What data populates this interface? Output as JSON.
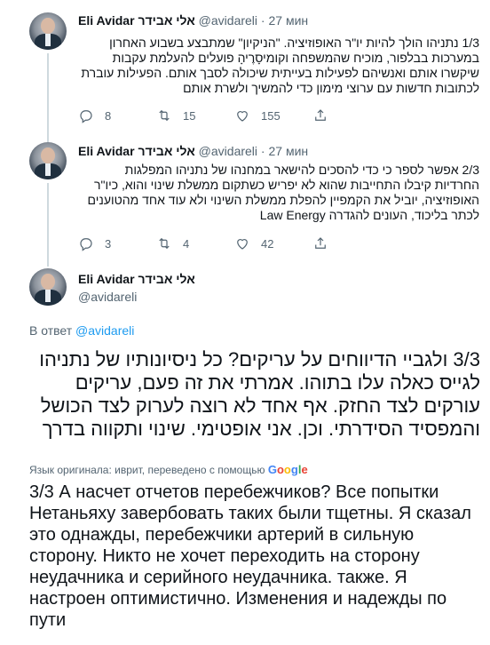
{
  "tweets": [
    {
      "name": "Eli Avidar אלי אבידר",
      "handle": "@avidareli",
      "separator": "·",
      "time": "27 мин",
      "text": "1/3 נתניהו הולך להיות יו\"ר האופוזיציה. \"הניקיון\" שמתבצע בשבוע האחרון במערכות בבלפור, מוכיח שהמשפחה וקומיסָרֶיהָ פועלים להעלמת עקבות שיקשרו אותם ואנשיהם לפעילות בעייתית שיכולה לסבך אותם. הפעילות עוברת לכתובות חדשות עם ערוצי מימון כדי להמשיך ולשרת אותם",
      "replies": "8",
      "retweets": "15",
      "likes": "155"
    },
    {
      "name": "Eli Avidar אלי אבידר",
      "handle": "@avidareli",
      "separator": "·",
      "time": "27 мин",
      "text": "2/3 אפשר לספר כי כדי להסכים להישאר במחנהו של נתניהו המפלגות החרדיות קיבלו התחייבות שהוא לא יפריש כשתקום ממשלת שינוי והוא, כיו\"ר האופוזיציה, יוביל את הקמפיין להפלת ממשלת השינוי ולא עוד אחד מהטוענים לכתר בליכוד, העונים להגדרה Law Energy",
      "replies": "3",
      "retweets": "4",
      "likes": "42"
    }
  ],
  "main_tweet": {
    "name": "Eli Avidar אלי אבידר",
    "handle": "@avidareli",
    "reply_prefix": "В ответ",
    "reply_handle": "@avidareli",
    "hebrew_text": "3/3 ולגביי הדיווחים על עריקים? כל ניסיונותיו של נתניהו לגייס כאלה עלו בתוהו. אמרתי את זה פעם, עריקים עורקים לצד החזק. אף אחד לא רוצה לערוק לצד הכושל והמפסיד הסידרתי. וכן. אני אופטימי. שינוי ותקווה בדרך",
    "translation_note": "Язык оригинала: иврит, переведено с помощью",
    "google_letters": [
      "G",
      "o",
      "o",
      "g",
      "l",
      "e"
    ],
    "translated_text": "3/3 А насчет отчетов перебежчиков? Все попытки Нетаньяху завербовать таких были тщетны. Я сказал это однажды, перебежчики артерий в сильную сторону. Никто не хочет переходить на сторону неудачника и серийного неудачника. также. Я настроен оптимистично. Изменения и надежды по пути"
  },
  "icons": {
    "reply": "reply-icon",
    "retweet": "retweet-icon",
    "like": "heart-icon",
    "share": "share-icon"
  },
  "colors": {
    "link": "#1d9bf0",
    "secondary_text": "#536471",
    "thread_line": "#cfd9de"
  }
}
